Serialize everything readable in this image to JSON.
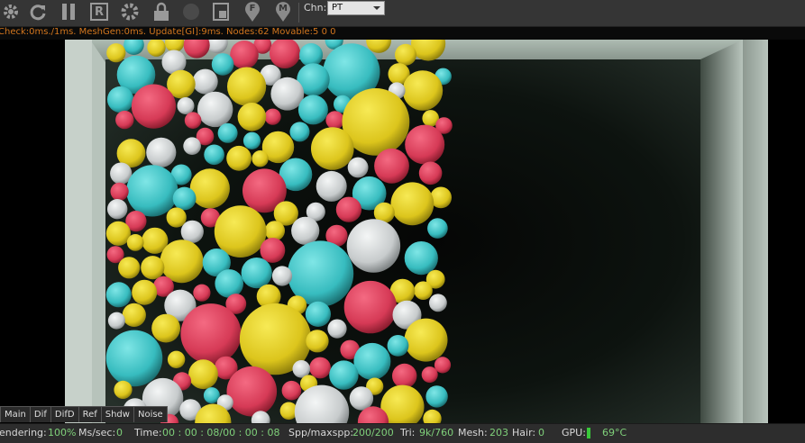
{
  "toolbar": {
    "icons": [
      "gear-icon",
      "refresh-icon",
      "pause-icon",
      "r-icon",
      "settings-gear-icon",
      "lock-icon",
      "circle-icon",
      "frame-icon",
      "f-pin-icon",
      "m-pin-icon"
    ],
    "r_letter": "R",
    "f_letter": "F",
    "m_letter": "M",
    "channel_label": "Chn:",
    "channel_value": "PT"
  },
  "stats_line": "Check:0ms./1ms. MeshGen:0ms. Update[GI]:9ms. Nodes:62 Movable:5  0 0",
  "tabs": [
    "Main",
    "Dif",
    "DifD",
    "Ref",
    "Shdw",
    "Noise"
  ],
  "status": {
    "rendering_label": "endering:",
    "rendering_value": "100%",
    "mssec_label": "Ms/sec:",
    "mssec_value": "0",
    "time_label": "Time:",
    "time_value": "00 : 00 : 08/00 : 00 : 08",
    "spp_label": "Spp/maxspp:",
    "spp_value": "200/200",
    "tri_label": "Tri:",
    "tri_value": "9k/760",
    "mesh_label": "Mesh:",
    "mesh_value": "203",
    "hair_label": "Hair:",
    "hair_value": "0",
    "gpu_label": "GPU:",
    "gpu_temp": "69°C"
  },
  "colors": {
    "accent_orange": "#d2761e",
    "value_green": "#7fd07a",
    "ball_pink": "#e2455f",
    "ball_yellow": "#e7d22a",
    "ball_cyan": "#3fc6c8",
    "ball_white": "#d4d7d8"
  }
}
